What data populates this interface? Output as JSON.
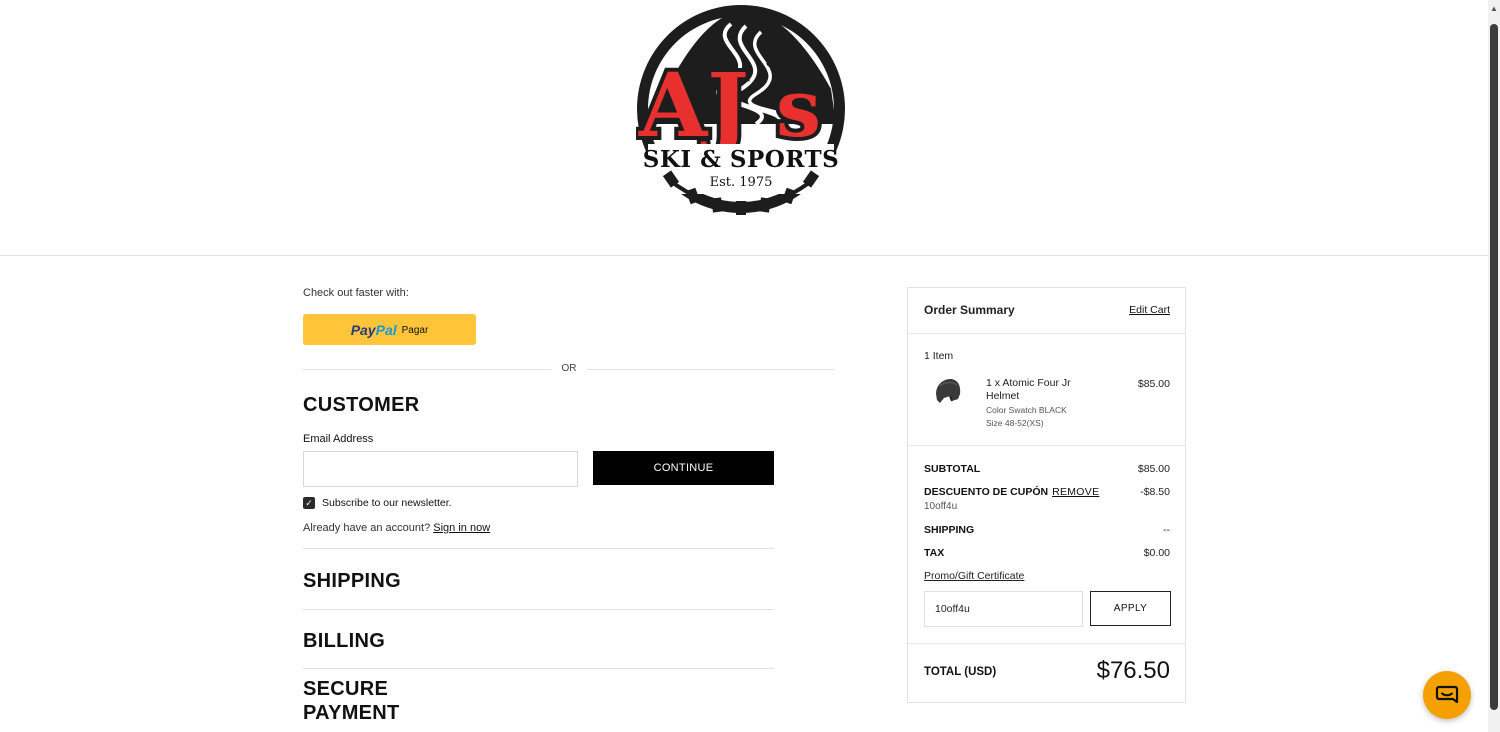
{
  "brand": {
    "logo_name": "SKI & SPORTS",
    "logo_mark": "AJ's",
    "logo_est": "Est. 1975",
    "accent_red": "#e8312f",
    "logo_dark": "#1d1d1d"
  },
  "express": {
    "label": "Check out faster with:",
    "paypal_word1": "Pay",
    "paypal_word2": "Pal",
    "paypal_action": "Pagar",
    "paypal_color": "#ffc439",
    "or_text": "OR"
  },
  "customer": {
    "title": "CUSTOMER",
    "email_label": "Email Address",
    "email_value": "",
    "continue_label": "CONTINUE",
    "newsletter_label": "Subscribe to our newsletter.",
    "newsletter_checked": true,
    "account_text": "Already have an account?",
    "sign_in_link": "Sign in now"
  },
  "steps": {
    "shipping": "SHIPPING",
    "billing": "BILLING",
    "payment_line1": "SECURE",
    "payment_line2": "PAYMENT"
  },
  "summary": {
    "title": "Order Summary",
    "edit_cart": "Edit Cart",
    "item_count": "1 Item",
    "items": [
      {
        "name": "1 x Atomic Four Jr Helmet",
        "option1": "Color Swatch BLACK",
        "option2": "Size 48-52(XS)",
        "price": "$85.00",
        "icon": "helmet-image"
      }
    ],
    "subtotal_label": "SUBTOTAL",
    "subtotal_value": "$85.00",
    "coupon_label": "DESCUENTO DE CUPÓN",
    "coupon_remove": "REMOVE",
    "coupon_value": "-$8.50",
    "coupon_code": "10off4u",
    "shipping_label": "SHIPPING",
    "shipping_value": "--",
    "tax_label": "TAX",
    "tax_value": "$0.00",
    "promo_link": "Promo/Gift Certificate",
    "promo_value": "10off4u",
    "apply_label": "APPLY",
    "total_label": "TOTAL (USD)",
    "total_value": "$76.50"
  },
  "chat": {
    "icon": "chat-bubble-icon",
    "color": "#f4a100"
  }
}
